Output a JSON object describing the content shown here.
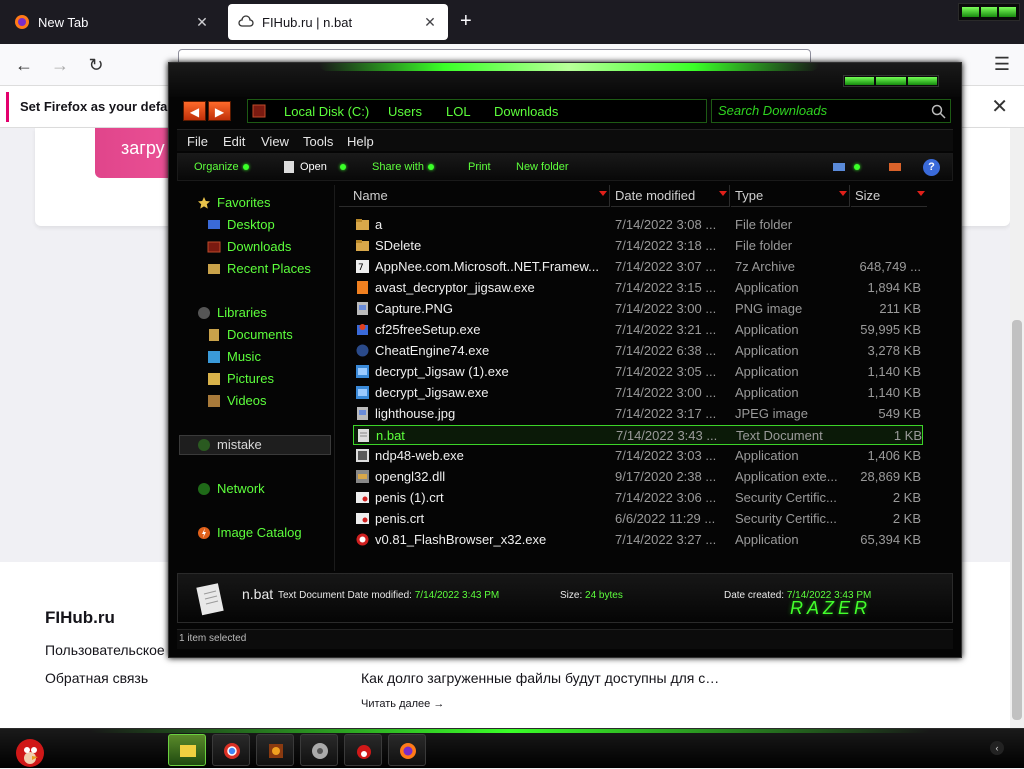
{
  "browser": {
    "tabs": [
      {
        "label": "New Tab",
        "active": false
      },
      {
        "label": "FIHub.ru | n.bat",
        "active": true
      }
    ],
    "notification": "Set Firefox as your default"
  },
  "page": {
    "button_label": "загру",
    "footer": {
      "brand": "FIHub.ru",
      "link1": "Пользовательское",
      "link2": "Обратная связь",
      "faq": "Как долго загруженные файлы будут доступны для с…",
      "read_more": "Читать далее →"
    }
  },
  "explorer": {
    "breadcrumbs": [
      "Local Disk (C:)",
      "Users",
      "LOL",
      "Downloads"
    ],
    "search_placeholder": "Search Downloads",
    "menu": [
      "File",
      "Edit",
      "View",
      "Tools",
      "Help"
    ],
    "commands": [
      "Organize",
      "Open",
      "Share with",
      "Print",
      "New folder"
    ],
    "nav": {
      "favorites": "Favorites",
      "favorites_items": [
        "Desktop",
        "Downloads",
        "Recent Places"
      ],
      "libraries": "Libraries",
      "libraries_items": [
        "Documents",
        "Music",
        "Pictures",
        "Videos"
      ],
      "selected": "mistake",
      "network": "Network",
      "image_catalog": "Image Catalog"
    },
    "columns": [
      "Name",
      "Date modified",
      "Type",
      "Size"
    ],
    "files": [
      {
        "name": "a",
        "date": "7/14/2022 3:08 ...",
        "type": "File folder",
        "size": "",
        "icon": "folder"
      },
      {
        "name": "SDelete",
        "date": "7/14/2022 3:18 ...",
        "type": "File folder",
        "size": "",
        "icon": "folder"
      },
      {
        "name": "AppNee.com.Microsoft..NET.Framew...",
        "date": "7/14/2022 3:07 ...",
        "type": "7z Archive",
        "size": "648,749 ...",
        "icon": "archive"
      },
      {
        "name": "avast_decryptor_jigsaw.exe",
        "date": "7/14/2022 3:15 ...",
        "type": "Application",
        "size": "1,894 KB",
        "icon": "avast"
      },
      {
        "name": "Capture.PNG",
        "date": "7/14/2022 3:00 ...",
        "type": "PNG image",
        "size": "211 KB",
        "icon": "image"
      },
      {
        "name": "cf25freeSetup.exe",
        "date": "7/14/2022 3:21 ...",
        "type": "Application",
        "size": "59,995 KB",
        "icon": "setup"
      },
      {
        "name": "CheatEngine74.exe",
        "date": "7/14/2022 6:38 ...",
        "type": "Application",
        "size": "3,278 KB",
        "icon": "cheat"
      },
      {
        "name": "decrypt_Jigsaw (1).exe",
        "date": "7/14/2022 3:05 ...",
        "type": "Application",
        "size": "1,140 KB",
        "icon": "app"
      },
      {
        "name": "decrypt_Jigsaw.exe",
        "date": "7/14/2022 3:00 ...",
        "type": "Application",
        "size": "1,140 KB",
        "icon": "app"
      },
      {
        "name": "lighthouse.jpg",
        "date": "7/14/2022 3:17 ...",
        "type": "JPEG image",
        "size": "549 KB",
        "icon": "image"
      },
      {
        "name": "n.bat",
        "date": "7/14/2022 3:43 ...",
        "type": "Text Document",
        "size": "1 KB",
        "icon": "text",
        "selected": true
      },
      {
        "name": "ndp48-web.exe",
        "date": "7/14/2022 3:03 ...",
        "type": "Application",
        "size": "1,406 KB",
        "icon": "ndp"
      },
      {
        "name": "opengl32.dll",
        "date": "9/17/2020 2:38 ...",
        "type": "Application exte...",
        "size": "28,869 KB",
        "icon": "dll"
      },
      {
        "name": "penis (1).crt",
        "date": "7/14/2022 3:06 ...",
        "type": "Security Certific...",
        "size": "2 KB",
        "icon": "cert"
      },
      {
        "name": "penis.crt",
        "date": "6/6/2022 11:29 ...",
        "type": "Security Certific...",
        "size": "2 KB",
        "icon": "cert"
      },
      {
        "name": "v0.81_FlashBrowser_x32.exe",
        "date": "7/14/2022 3:27 ...",
        "type": "Application",
        "size": "65,394 KB",
        "icon": "flash"
      }
    ],
    "details": {
      "name": "n.bat",
      "type": "Text Document",
      "date_modified_label": "Date modified:",
      "date_modified": "7/14/2022 3:43 PM",
      "size_label": "Size:",
      "size": "24 bytes",
      "date_created_label": "Date created:",
      "date_created": "7/14/2022 3:43 PM"
    },
    "brand_logo": "RAZER",
    "status": "1 item selected"
  },
  "taskbar": {
    "apps": [
      "explorer-icon",
      "chrome-icon",
      "app-icon",
      "disc-icon",
      "angry-bird-icon",
      "firefox-icon"
    ]
  },
  "colors": {
    "accent": "#3aff28",
    "text_green": "#5dff3c",
    "background": "#050505"
  }
}
